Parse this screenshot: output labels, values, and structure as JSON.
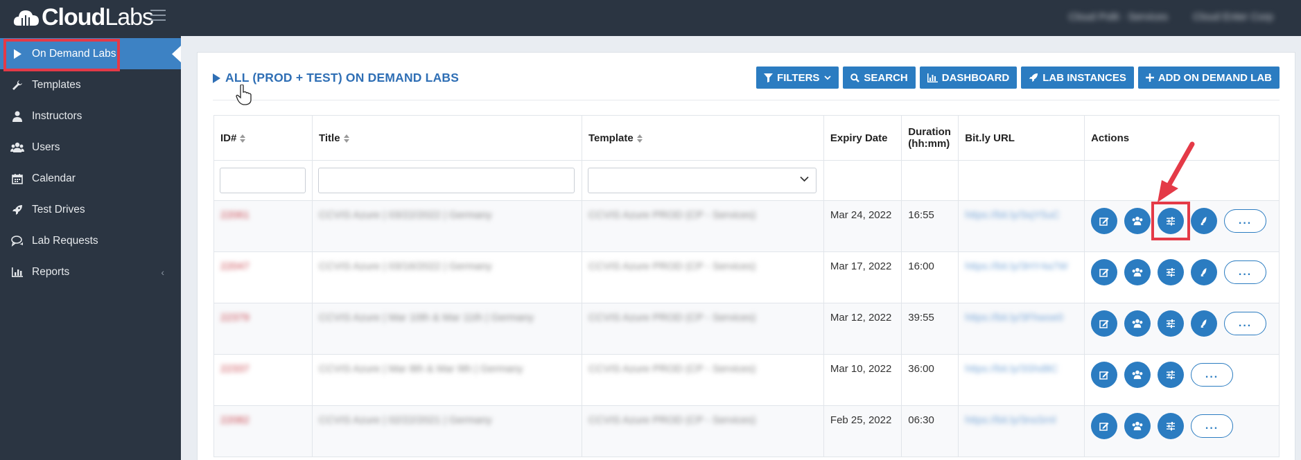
{
  "brand": {
    "logo_bold": "Cloud",
    "logo_light": "Labs"
  },
  "topbar": {
    "user_menu": "Cloud Polit · Services",
    "org_menu": "Cloud Enter Corp"
  },
  "sidebar": {
    "items": [
      {
        "label": "On Demand Labs",
        "icon": "play-icon",
        "active": true
      },
      {
        "label": "Templates",
        "icon": "wrench-icon"
      },
      {
        "label": "Instructors",
        "icon": "user-icon"
      },
      {
        "label": "Users",
        "icon": "users-icon"
      },
      {
        "label": "Calendar",
        "icon": "calendar-icon"
      },
      {
        "label": "Test Drives",
        "icon": "rocket-icon"
      },
      {
        "label": "Lab Requests",
        "icon": "comments-icon"
      },
      {
        "label": "Reports",
        "icon": "bar-chart-icon",
        "arrow": "‹"
      }
    ]
  },
  "main": {
    "title": "ALL (PROD + TEST) ON DEMAND LABS",
    "buttons": {
      "filters": "FILTERS",
      "search": "SEARCH",
      "dashboard": "DASHBOARD",
      "lab_instances": "LAB INSTANCES",
      "add": "ADD ON DEMAND LAB"
    }
  },
  "table": {
    "columns": [
      "ID#",
      "Title",
      "Template",
      "Expiry Date",
      "Duration (hh:mm)",
      "Bit.ly URL",
      "Actions"
    ],
    "duration_line1": "Duration",
    "duration_line2": "(hh:mm)",
    "more_label": "...",
    "rows": [
      {
        "id": "22061",
        "title": "CCVIS Azure | 03/22/2022 | Germany",
        "template": "CCVIS Azure PROD (CP - Services)",
        "expiry": "Mar 24, 2022",
        "duration": "16:55",
        "url": "https://bit.ly/3xjY5uC",
        "rocket": true
      },
      {
        "id": "22047",
        "title": "CCVIS Azure | 03/16/2022 | Germany",
        "template": "CCVIS Azure PROD (CP - Services)",
        "expiry": "Mar 17, 2022",
        "duration": "16:00",
        "url": "https://bit.ly/3HY4a7W",
        "rocket": true
      },
      {
        "id": "22379",
        "title": "CCVIS Azure | Mar 10th & Mar 11th | Germany",
        "template": "CCVIS Azure PROD (CP - Services)",
        "expiry": "Mar 12, 2022",
        "duration": "39:55",
        "url": "https://bit.ly/3Fhwoe0",
        "rocket": true
      },
      {
        "id": "22337",
        "title": "CCVIS Azure | Mar 8th & Mar 9th | Germany",
        "template": "CCVIS Azure PROD (CP - Services)",
        "expiry": "Mar 10, 2022",
        "duration": "36:00",
        "url": "https://bit.ly/3Shd8C",
        "rocket": false
      },
      {
        "id": "22082",
        "title": "CCVIS Azure | 02/22/2021 | Germany",
        "template": "CCVIS Azure PROD (CP - Services)",
        "expiry": "Feb 25, 2022",
        "duration": "06:30",
        "url": "https://bit.ly/3nsSrnl",
        "rocket": false
      }
    ]
  },
  "colors": {
    "accent": "#2b7cc1",
    "sidebar_bg": "#2b3542",
    "highlight": "#e43a47",
    "title": "#2f6fb5"
  }
}
